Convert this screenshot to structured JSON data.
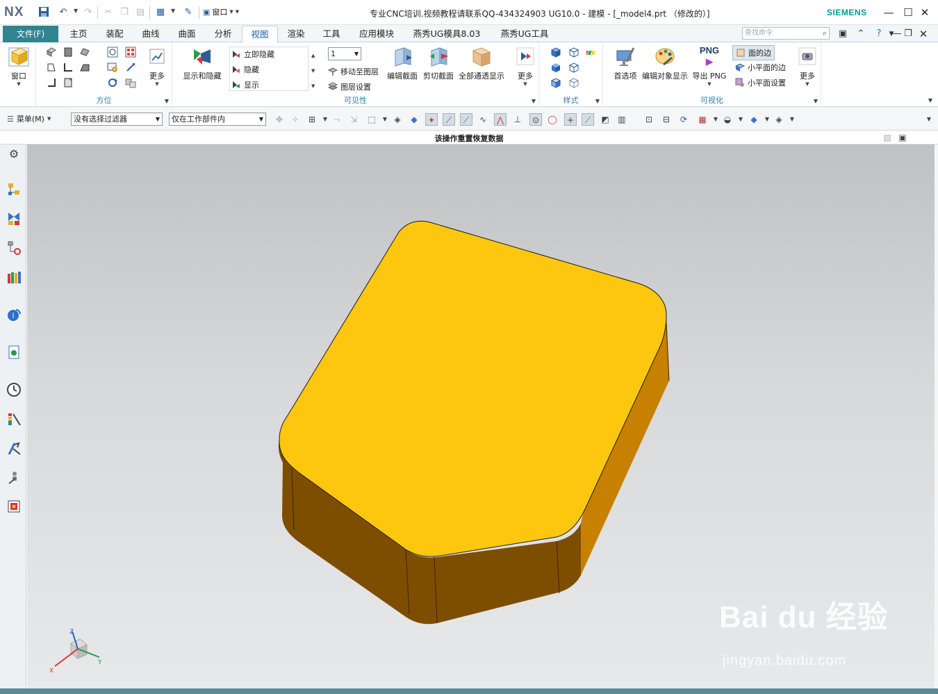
{
  "app": {
    "logo": "NX",
    "window_title": "专业CNC培训.视频教程请联系QQ-434324903 UG10.0 - 建模 - [_model4.prt （修改的）]",
    "brand": "SIEMENS",
    "quick_access": {
      "window_label": "窗口"
    }
  },
  "menu": {
    "file_label": "文件(F)",
    "tabs": [
      {
        "label": "主页"
      },
      {
        "label": "装配"
      },
      {
        "label": "曲线"
      },
      {
        "label": "曲面"
      },
      {
        "label": "分析"
      },
      {
        "label": "视图",
        "active": true
      },
      {
        "label": "渲染"
      },
      {
        "label": "工具"
      },
      {
        "label": "应用模块"
      },
      {
        "label": "燕秀UG模具8.03"
      },
      {
        "label": "燕秀UG工具"
      }
    ],
    "search_placeholder": "查找命令"
  },
  "ribbon": {
    "window_btn": "窗口",
    "orientation": {
      "more": "更多",
      "group_label": "方位"
    },
    "visibility": {
      "show_hide": "显示和隐藏",
      "immediate_hide": "立即隐藏",
      "hide": "隐藏",
      "show": "显示",
      "layer_value": "1",
      "move_to_layer": "移动至图层",
      "layer_settings": "图层设置",
      "edit_section": "编辑截面",
      "clip_section": "剪切截面",
      "all_see_through": "全部通透显示",
      "more": "更多",
      "group_label": "可见性"
    },
    "style": {
      "group_label": "样式"
    },
    "visualization": {
      "preferences": "首选项",
      "edit_object_display": "编辑对象显示",
      "export_png_top": "PNG",
      "export_png": "导出 PNG",
      "face_edges": "面的边",
      "facet_edges": "小平面的边",
      "facet_settings": "小平面设置",
      "more": "更多",
      "group_label": "可视化"
    }
  },
  "selection_bar": {
    "menu_label": "菜单(M)",
    "filter": "没有选择过滤器",
    "scope": "仅在工作部件内"
  },
  "status": {
    "message": "该操作重置恢复数据"
  },
  "colors": {
    "accent": "#30848f",
    "top_face": "#fdc710",
    "side_light": "#c88000",
    "side_dark": "#7d4e00",
    "siemens": "#009999"
  },
  "triad": {
    "x": "X",
    "y": "Y",
    "z": "Z"
  },
  "watermark": {
    "logo": "Bai du 经验",
    "url": "jingyan.baidu.com"
  }
}
